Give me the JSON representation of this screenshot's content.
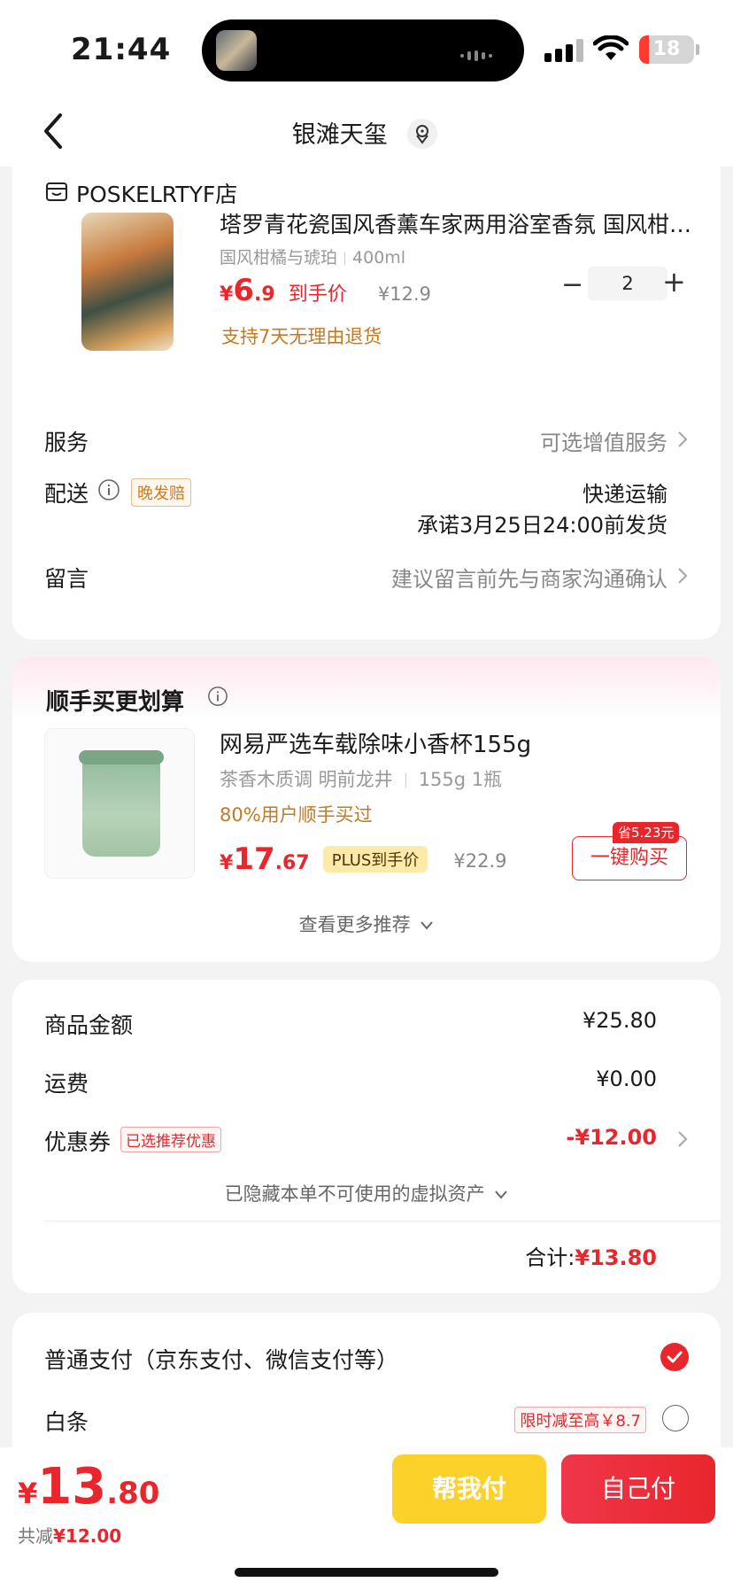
{
  "status_bar": {
    "time": "21:44",
    "battery": "18",
    "battery_level": 0.18
  },
  "nav": {
    "title": "银滩天玺"
  },
  "shop": {
    "name": "POSKELRTYF店"
  },
  "product": {
    "title": "塔罗青花瓷国风香薰车家两用浴室香氛 国风柑橘与琥珀",
    "spec1": "国风柑橘与琥珀",
    "spec2": "400ml",
    "currency": "¥",
    "price_int": "6",
    "price_dec": ".9",
    "price_label": "到手价",
    "orig_price": "¥12.9",
    "qty_minus": "−",
    "quantity": "2",
    "qty_plus": "+",
    "return_policy": "支持7天无理由退货"
  },
  "rows": {
    "service_label": "服务",
    "service_value": "可选增值服务",
    "delivery_label": "配送",
    "delivery_tag": "晚发赔",
    "delivery_method": "快递运输",
    "delivery_promise": "承诺3月25日24:00前发货",
    "message_label": "留言",
    "message_placeholder": "建议留言前先与商家沟通确认"
  },
  "recommend": {
    "title": "顺手买更划算",
    "product_title": "网易严选车载除味小香杯155g",
    "spec1": "茶香木质调 明前龙井",
    "spec2": "155g 1瓶",
    "bought": "80%用户顺手买过",
    "currency": "¥",
    "price_int": "17",
    "price_dec": ".67",
    "plus_label": "PLUS到手价",
    "orig_price": "¥22.9",
    "save_badge": "省5.23元",
    "buy_label": "一键购买",
    "more_label": "查看更多推荐"
  },
  "summary": {
    "goods_label": "商品金额",
    "goods_value": "¥25.80",
    "shipping_label": "运费",
    "shipping_value": "¥0.00",
    "coupon_label": "优惠券",
    "coupon_tag": "已选推荐优惠",
    "coupon_value": "-¥12.00",
    "hidden_assets": "已隐藏本单不可使用的虚拟资产",
    "total_label": "合计:",
    "total_value": "¥13.80"
  },
  "payment": {
    "normal_label": "普通支付（京东支付、微信支付等）",
    "baitiao_label": "白条",
    "baitiao_promo": "限时减至高￥8.7"
  },
  "bottom": {
    "currency": "¥",
    "total_int": "13",
    "total_dec": ".80",
    "save_prefix": "共减",
    "save_value": "¥12.00",
    "help_pay": "帮我付",
    "self_pay": "自己付"
  },
  "colors": {
    "accent": "#e8262c",
    "help_button": "#fcd12a",
    "return_text": "#c47a24"
  }
}
